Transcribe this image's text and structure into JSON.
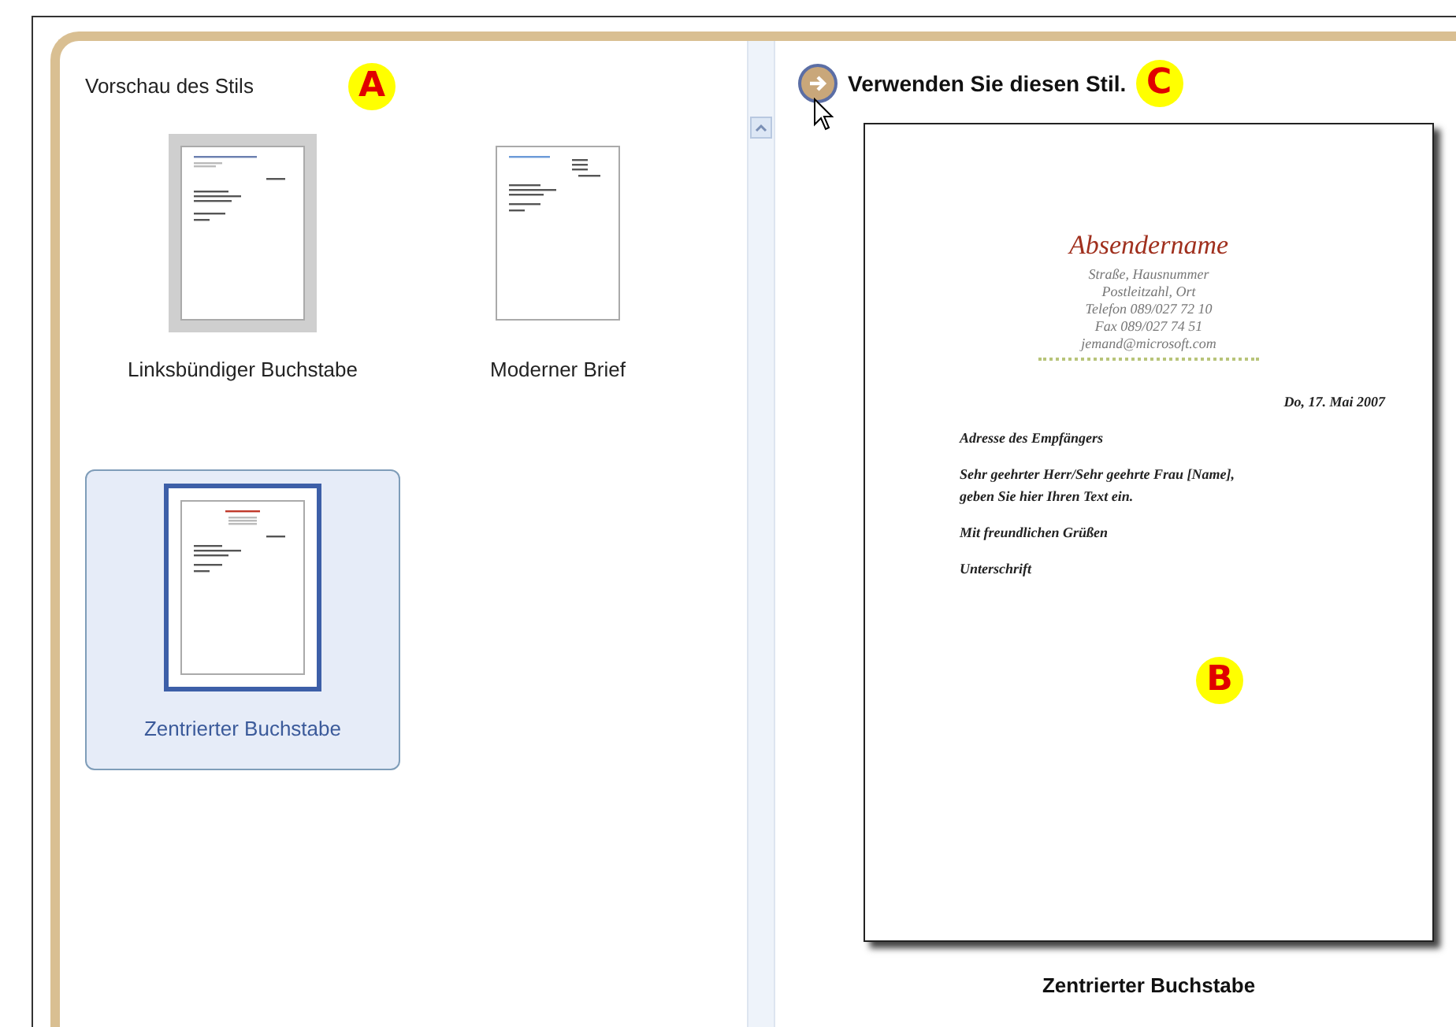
{
  "styles_panel": {
    "title": "Vorschau des Stils",
    "callout": "A",
    "items": [
      {
        "label": "Linksbündiger Buchstabe",
        "kind": "left",
        "selected": false,
        "hovered": true
      },
      {
        "label": "Moderner Brief",
        "kind": "modern",
        "selected": false,
        "hovered": false
      },
      {
        "label": "Zentrierter Buchstabe",
        "kind": "centered",
        "selected": true,
        "hovered": false
      }
    ]
  },
  "preview": {
    "action": "Verwenden Sie diesen Stil.",
    "action_callout": "C",
    "page_callout": "B",
    "letter": {
      "sender_name": "Absendername",
      "sender_lines": [
        "Straße, Hausnummer",
        "Postleitzahl, Ort",
        "Telefon 089/027 72 10",
        "Fax 089/027 74 51",
        "jemand@microsoft.com"
      ],
      "date": "Do, 17. Mai 2007",
      "recipient": "Adresse des Empfängers",
      "body": [
        "Sehr geehrter Herr/Sehr geehrte Frau [Name],",
        "geben Sie hier Ihren Text ein."
      ],
      "closing": "Mit freundlichen Grüßen",
      "signature": "Unterschrift"
    },
    "caption": "Zentrierter Buchstabe"
  }
}
